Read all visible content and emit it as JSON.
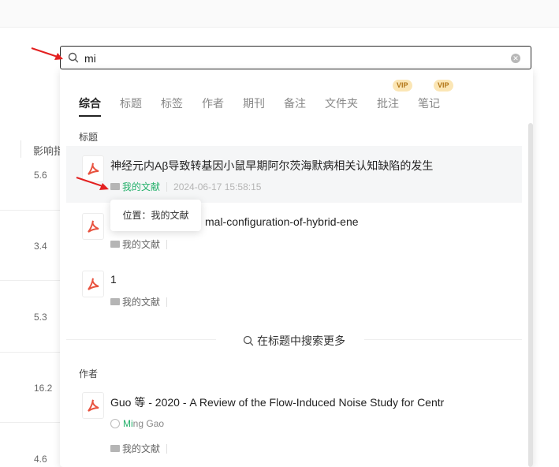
{
  "search": {
    "value": "mi"
  },
  "background": {
    "column_title": "影响指",
    "values": [
      "5.6",
      "3.4",
      "5.3",
      "16.2",
      "4.6"
    ]
  },
  "tabs": [
    {
      "label": "综合",
      "active": true
    },
    {
      "label": "标题"
    },
    {
      "label": "标签"
    },
    {
      "label": "作者"
    },
    {
      "label": "期刊"
    },
    {
      "label": "备注"
    },
    {
      "label": "文件夹"
    },
    {
      "label": "批注",
      "badge": "VIP"
    },
    {
      "label": "笔记",
      "badge": "VIP"
    }
  ],
  "sections": {
    "title_label": "标题",
    "author_label": "作者"
  },
  "results": [
    {
      "title": "神经元内Aβ导致转基因小鼠早期阿尔茨海默病相关认知缺陷的发生",
      "location": "我的文献",
      "time": "2024-06-17 15:58:15"
    },
    {
      "title": "mal-configuration-of-hybrid-ene",
      "location": "我的文献"
    },
    {
      "title": "1",
      "location": "我的文献"
    }
  ],
  "tooltip": "位置：我的文献",
  "search_more": "在标题中搜索更多",
  "author_results": [
    {
      "title": "Guo 等 - 2020 - A Review of the Flow-Induced Noise Study for Centr",
      "author_match": "Mi",
      "author_rest": "ng Gao",
      "location": "我的文献"
    }
  ],
  "colors": {
    "accent_green": "#23b06a",
    "pdf_red": "#e8523f",
    "vip_bg": "#fbe6b5"
  }
}
